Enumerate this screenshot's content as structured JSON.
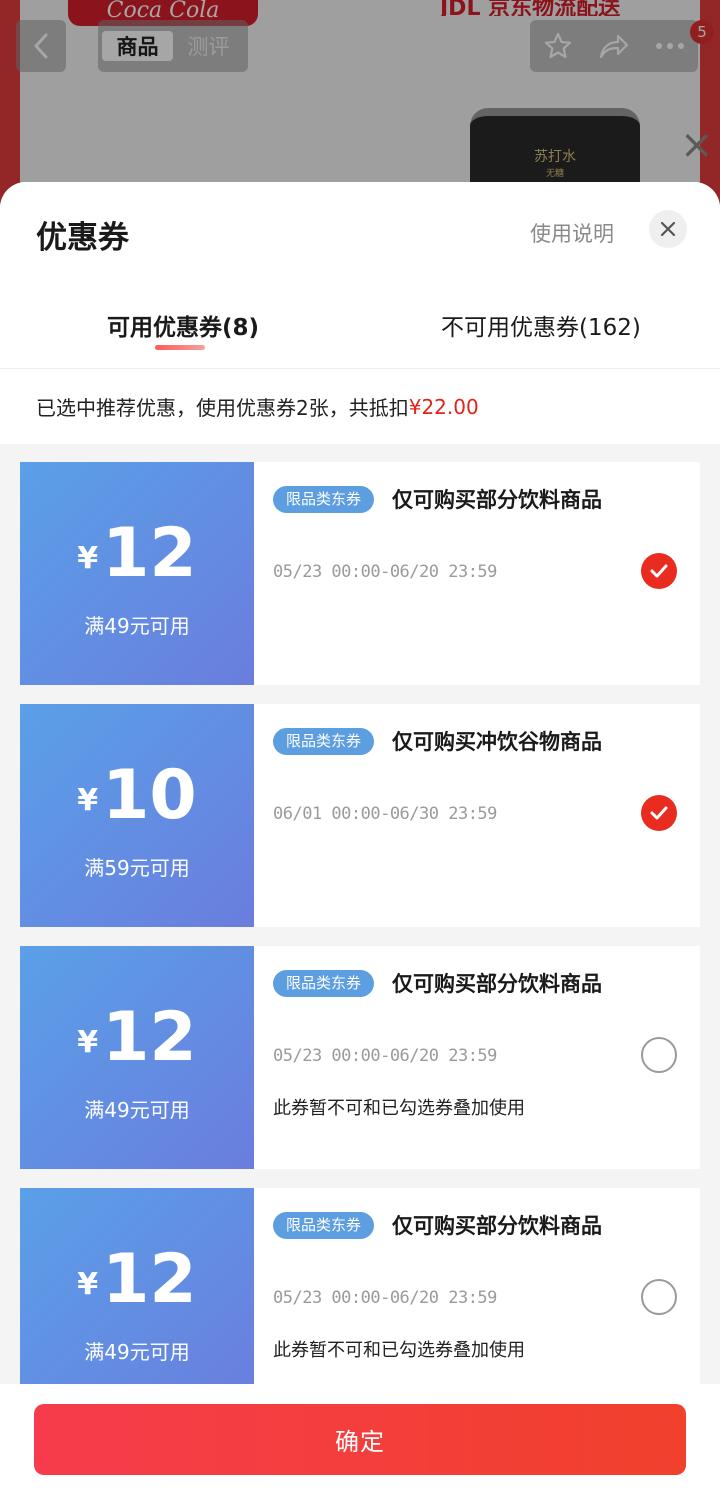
{
  "background": {
    "brand_text": "Coca Cola",
    "logistics_text": "JDL 京东物流配送",
    "product_can_line1": "苏打水",
    "product_can_line2": "无糖",
    "segment_tabs": [
      "商品",
      "测评"
    ],
    "notification_count": "5"
  },
  "sheet": {
    "title": "优惠券",
    "help_link": "使用说明",
    "tabs": [
      {
        "label": "可用优惠券(8)",
        "active": true
      },
      {
        "label": "不可用优惠券(162)",
        "active": false
      }
    ],
    "summary_prefix": "已选中推荐优惠，使用优惠券2张，共抵扣",
    "summary_amount": "¥22.00"
  },
  "coupons": [
    {
      "yen": "¥",
      "amount": "12",
      "condition": "满49元可用",
      "tag": "限品类东券",
      "title": "仅可购买部分饮料商品",
      "validity": "05/23 00:00-06/20 23:59",
      "note": "",
      "selected": true
    },
    {
      "yen": "¥",
      "amount": "10",
      "condition": "满59元可用",
      "tag": "限品类东券",
      "title": "仅可购买冲饮谷物商品",
      "validity": "06/01 00:00-06/30 23:59",
      "note": "",
      "selected": true
    },
    {
      "yen": "¥",
      "amount": "12",
      "condition": "满49元可用",
      "tag": "限品类东券",
      "title": "仅可购买部分饮料商品",
      "validity": "05/23 00:00-06/20 23:59",
      "note": "此券暂不可和已勾选券叠加使用",
      "selected": false
    },
    {
      "yen": "¥",
      "amount": "12",
      "condition": "满49元可用",
      "tag": "限品类东券",
      "title": "仅可购买部分饮料商品",
      "validity": "05/23 00:00-06/20 23:59",
      "note": "此券暂不可和已勾选券叠加使用",
      "selected": false
    }
  ],
  "footer": {
    "confirm_label": "确定"
  },
  "colors": {
    "accent_red": "#ea2b1f",
    "coupon_blue_start": "#5aa0e8",
    "coupon_blue_end": "#6a7ddd",
    "tag_blue": "#5c9ee0"
  }
}
